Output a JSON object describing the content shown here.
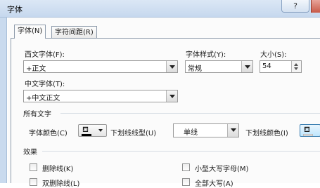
{
  "window": {
    "title": "字体",
    "help_label": "?"
  },
  "tabs": [
    {
      "label": "字体(N)",
      "active": true
    },
    {
      "label": "字符间距(R)",
      "active": false
    }
  ],
  "western_font": {
    "label": "西文字体(F):",
    "value": "+正文"
  },
  "font_style": {
    "label": "字体样式(Y):",
    "value": "常规"
  },
  "font_size": {
    "label": "大小(S):",
    "value": "54"
  },
  "asian_font": {
    "label": "中文字体(T):",
    "value": "+中文正文"
  },
  "all_text": {
    "section_title": "所有文字",
    "font_color_label": "字体颜色(C)",
    "font_color": "#000000",
    "underline_style_label": "下划线线型(U)",
    "underline_style_value": "单线",
    "underline_color_label": "下划线颜色(I)",
    "underline_color": "#ffffff"
  },
  "effects": {
    "section_title": "效果",
    "strikethrough": "删除线(K)",
    "double_strikethrough": "双删除线(L)",
    "small_caps": "小型大写字母(M)",
    "all_caps": "全部大写(A)"
  },
  "icons": {
    "paint_bucket": "paint-bucket-icon",
    "dropdown": "chevron-down-icon"
  }
}
